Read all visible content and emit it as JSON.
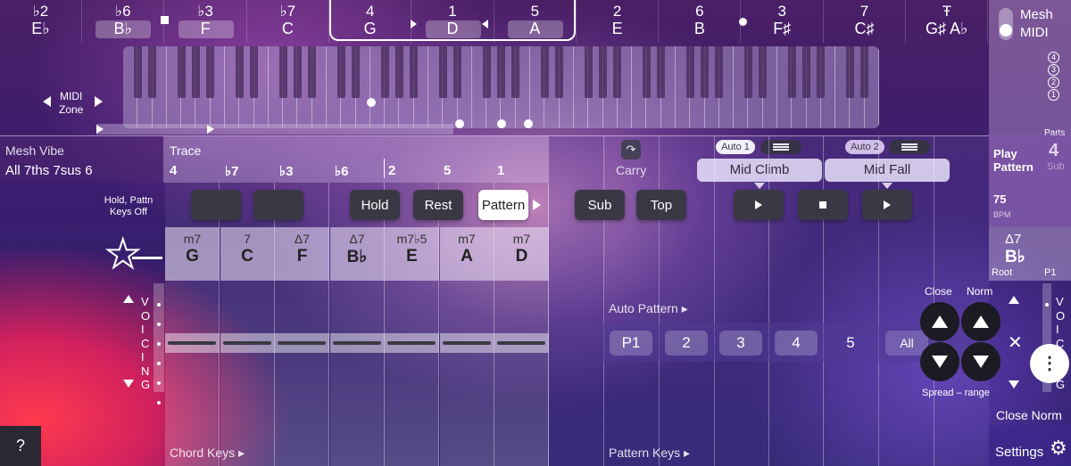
{
  "top_keys": [
    {
      "deg": "♭2",
      "note": "E♭",
      "box": false
    },
    {
      "deg": "♭6",
      "note": "B♭",
      "box": true
    },
    {
      "deg": "♭3",
      "note": "F",
      "box": true
    },
    {
      "deg": "♭7",
      "note": "C",
      "box": false
    },
    {
      "deg": "4",
      "note": "G",
      "box": false
    },
    {
      "deg": "1",
      "note": "D",
      "box": true
    },
    {
      "deg": "5",
      "note": "A",
      "box": true
    },
    {
      "deg": "2",
      "note": "E",
      "box": false
    },
    {
      "deg": "6",
      "note": "B",
      "box": false
    },
    {
      "deg": "3",
      "note": "F♯",
      "box": false
    },
    {
      "deg": "7",
      "note": "C♯",
      "box": false
    },
    {
      "deg": "Ŧ",
      "note": "G♯ A♭",
      "box": false
    }
  ],
  "mode": {
    "mesh": "Mesh",
    "midi": "MIDI"
  },
  "parts_label": "Parts",
  "parts_count": "4",
  "parts_sub": "Sub",
  "part_numbers": [
    "4",
    "3",
    "2",
    "1"
  ],
  "midi_zone": "MIDI\nZone",
  "mesh_vibe": {
    "title": "Mesh Vibe",
    "value": "All 7ths 7sus 6"
  },
  "trace": {
    "label": "Trace",
    "degrees": [
      "4",
      "♭7",
      "♭3",
      "♭6",
      "2",
      "5",
      "1"
    ]
  },
  "carry": "Carry",
  "auto1": {
    "tag": "Auto 1",
    "name": "Mid Climb"
  },
  "auto2": {
    "tag": "Auto 2",
    "name": "Mid Fall"
  },
  "play_pattern": {
    "label": "Play\nPattern",
    "bpm": "75",
    "bpm_unit": "BPM"
  },
  "hold_pattern": "Hold, Pattn\nKeys Off",
  "buttons": {
    "hold": "Hold",
    "rest": "Rest",
    "pattern": "Pattern",
    "sub": "Sub",
    "top": "Top"
  },
  "chords": [
    {
      "q": "m7",
      "r": "G"
    },
    {
      "q": "7",
      "r": "C"
    },
    {
      "q": "Δ7",
      "r": "F"
    },
    {
      "q": "Δ7",
      "r": "B♭"
    },
    {
      "q": "m7♭5",
      "r": "E"
    },
    {
      "q": "m7",
      "r": "A"
    },
    {
      "q": "m7",
      "r": "D"
    }
  ],
  "root": {
    "q": "Δ7",
    "r": "B♭",
    "label": "Root",
    "part": "P1"
  },
  "voicing": "VOICING",
  "auto_pattern": "Auto Pattern ▸",
  "pattern_parts": [
    "P1",
    "2",
    "3",
    "4",
    "5",
    "All"
  ],
  "spread": {
    "close": "Close",
    "norm": "Norm",
    "label": "Spread – range"
  },
  "close_norm": "Close Norm",
  "chord_keys": "Chord Keys ▸",
  "pattern_keys": "Pattern Keys ▸",
  "settings": "Settings",
  "help": "?"
}
